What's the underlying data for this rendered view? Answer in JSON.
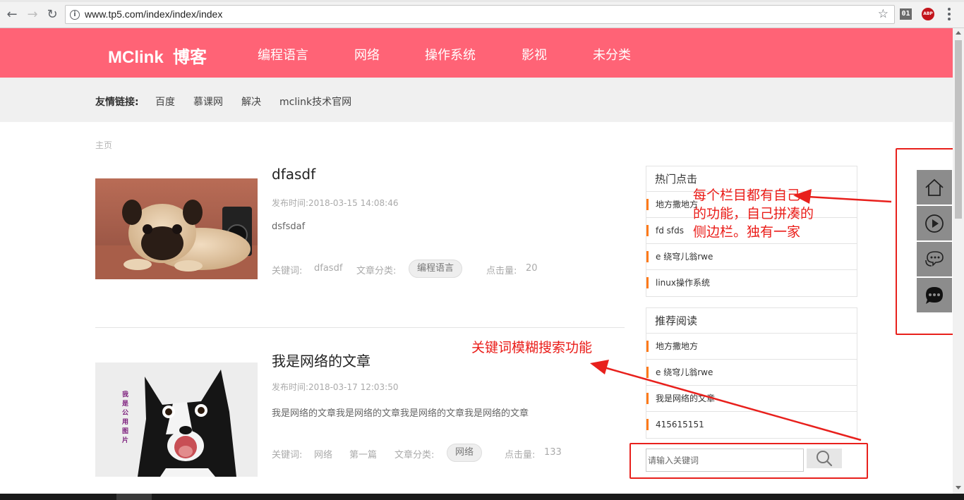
{
  "browser": {
    "url": "www.tp5.com/index/index/index",
    "back_glyph": "←",
    "forward_glyph": "→",
    "reload_glyph": "↻",
    "star_glyph": "☆",
    "info_glyph": "i",
    "ext1_label": "01",
    "ext2_label": "ABP"
  },
  "header": {
    "logo": "MClink  博客",
    "nav": [
      "编程语言",
      "网络",
      "操作系统",
      "影视",
      "未分类"
    ],
    "background": "#ff6376"
  },
  "friend_links": {
    "label": "友情链接:",
    "links": [
      "百度",
      "慕课网",
      "解决",
      "mclink技术官网"
    ]
  },
  "breadcrumb": "主页",
  "articles": [
    {
      "title": "dfasdf",
      "date": "发布时间:2018-03-15 14:08:46",
      "summary": "dsfsdaf",
      "keywords_label": "关键词:",
      "keywords": [
        "dfasdf"
      ],
      "category_label": "文章分类:",
      "category": "编程语言",
      "clicks_label": "点击量:",
      "clicks": "20"
    },
    {
      "title": "我是网络的文章",
      "date": "发布时间:2018-03-17 12:03:50",
      "summary": "我是网络的文章我是网络的文章我是网络的文章我是网络的文章",
      "keywords_label": "关键词:",
      "keywords": [
        "网络",
        "第一篇"
      ],
      "category_label": "文章分类:",
      "category": "网络",
      "clicks_label": "点击量:",
      "clicks": "133",
      "image_text": [
        "我",
        "是",
        "公",
        "用",
        "图",
        "片"
      ]
    }
  ],
  "sidebar": {
    "hot": {
      "title": "热门点击",
      "items": [
        "地方撒地方",
        "fd sfds",
        "e 绕穹儿翁rwe",
        "linux操作系统"
      ]
    },
    "recommended": {
      "title": "推荐阅读",
      "items": [
        "地方撒地方",
        "e 绕穹儿翁rwe",
        "我是网络的文章",
        "415615151"
      ]
    },
    "search": {
      "placeholder": "请输入关键词"
    }
  },
  "side_tools": [
    "home-icon",
    "play-icon",
    "comments-icon",
    "chat-icon"
  ],
  "annotations": {
    "sidebar_note": "每个栏目都有自己\n的功能，自己拼凑的\n侧边栏。独有一家",
    "search_note": "关键词模糊搜索功能",
    "color": "#ea1c18"
  }
}
